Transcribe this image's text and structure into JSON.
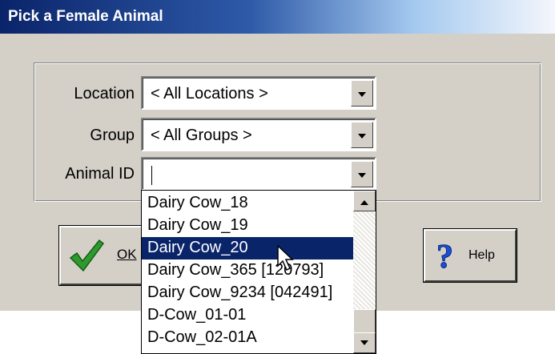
{
  "dialog": {
    "title": "Pick a Female Animal"
  },
  "fields": {
    "location": {
      "label": "Location",
      "value": "< All Locations >"
    },
    "group": {
      "label": "Group",
      "value": "< All Groups >"
    },
    "animal_id": {
      "label": "Animal ID",
      "value": ""
    }
  },
  "buttons": {
    "ok": {
      "label": "OK",
      "icon": "checkmark-icon"
    },
    "help": {
      "label": "Help",
      "icon": "question-mark-icon"
    }
  },
  "dropdown": {
    "items": [
      "Dairy Cow_18",
      "Dairy Cow_19",
      "Dairy Cow_20",
      "Dairy Cow_365 [120793]",
      "Dairy Cow_9234 [042491]",
      "D-Cow_01-01",
      "D-Cow_02-01A"
    ],
    "selected_index": 2
  },
  "colors": {
    "title_bar": "#0a246a",
    "selection": "#0a246a",
    "face": "#d4d0c8",
    "ok_check": "#2e9a2e",
    "help_icon": "#1c4fd6"
  }
}
